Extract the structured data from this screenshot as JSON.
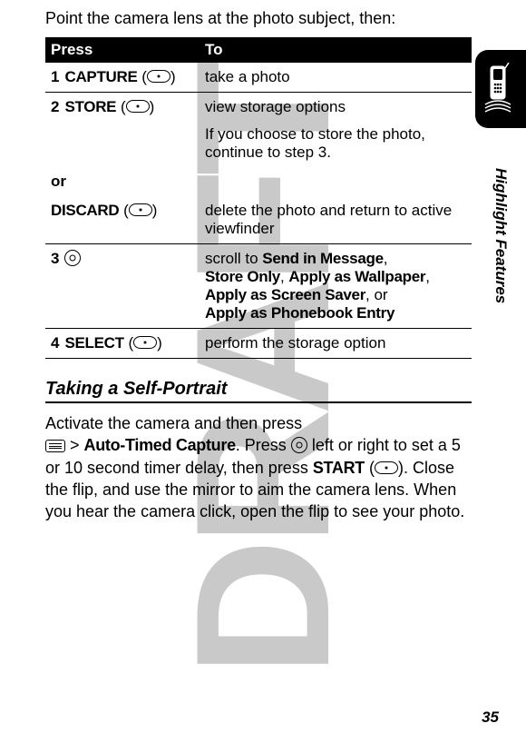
{
  "watermark": "DRAFT",
  "side_label": "Highlight Features",
  "page_number": "35",
  "intro": "Point the camera lens at the photo subject, then:",
  "table": {
    "header": {
      "press": "Press",
      "to": "To"
    },
    "row1": {
      "num": "1",
      "key": "CAPTURE",
      "to": "take a photo"
    },
    "row2": {
      "num": "2",
      "key": "STORE",
      "to1": "view storage options",
      "to2": "If you choose to store the photo, continue to step 3."
    },
    "or": "or",
    "row2b": {
      "key": "DISCARD",
      "to": "delete the photo and return to active viewfinder"
    },
    "row3": {
      "num": "3",
      "to_pre": "scroll to ",
      "opt1": "Send in Message",
      "opt2": "Store Only",
      "opt3": "Apply as Wallpaper",
      "opt4": "Apply as Screen Saver",
      "to_mid": ", or ",
      "opt5": "Apply as Phonebook Entry"
    },
    "row4": {
      "num": "4",
      "key": "SELECT",
      "to": "perform the storage option"
    }
  },
  "heading": "Taking a Self-Portrait",
  "body": {
    "p1": "Activate the camera and then press",
    "p2a": " > ",
    "p2b": "Auto-Timed Capture",
    "p2c": ". Press ",
    "p2d": " left or right to set a 5 or 10 second timer delay, then press ",
    "p2e": "START",
    "p2f": " (",
    "p2g": "). Close the flip, and use the mirror to aim the camera lens. When you hear the camera click, open the flip to see your photo."
  }
}
